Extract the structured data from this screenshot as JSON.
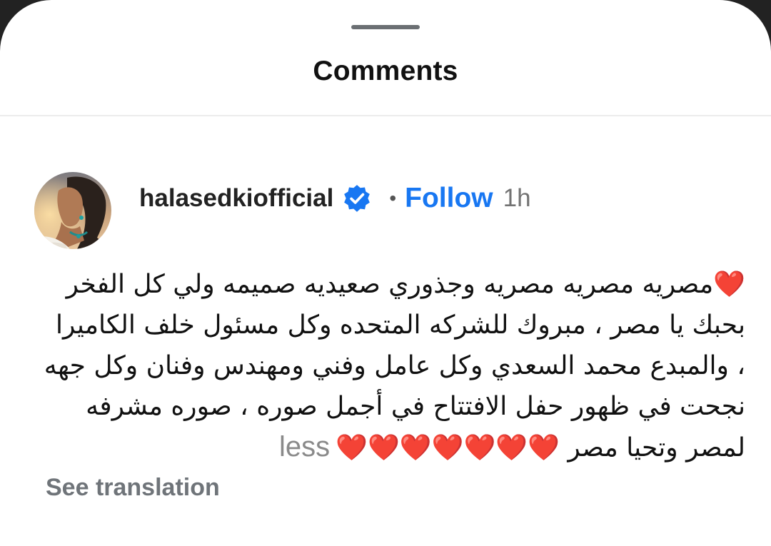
{
  "header": {
    "title": "Comments"
  },
  "comment": {
    "username": "halasedkiofficial",
    "follow_label": "Follow",
    "separator": "•",
    "time": "1h",
    "text": "مصريه مصريه مصريه وجذوري صعيديه  صميمه ولي كل الفخر بحبك يا مصر ، مبروك للشركه المتحده وكل مسئول خلف الكاميرا ، والمبدع محمد السعدي وكل عامل وفني ومهندس وفنان وكل جهه نجحت في ظهور حفل الافتتاح في أجمل صوره ، صوره مشرفه لمصر وتحيا مصر",
    "hearts_lead": "❤️",
    "hearts_tail": "❤️❤️❤️❤️❤️❤️❤️",
    "less_label": "less",
    "see_translation_label": "See translation"
  },
  "colors": {
    "follow": "#1877f2",
    "verified": "#1877f2",
    "heart": "#e11d2a"
  },
  "icons": {
    "verified": "verified-badge-icon",
    "heart": "heart-emoji"
  }
}
